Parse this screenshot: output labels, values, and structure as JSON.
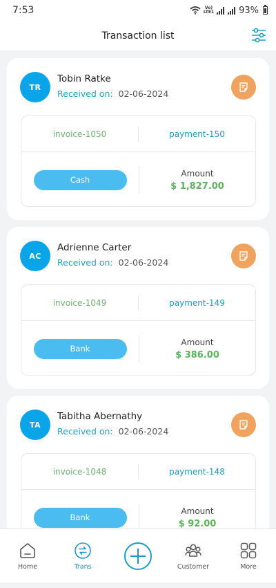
{
  "status_bar": {
    "time": "7:53",
    "lte_top": "Vo)",
    "lte_bottom": "LTE1",
    "battery": "93%"
  },
  "header": {
    "title": "Transaction list",
    "filter_icon": "sliders-icon"
  },
  "amount_label": "Amount",
  "received_label": "Received on:",
  "transactions": [
    {
      "initials": "TR",
      "name": "Tobin Ratke",
      "date": "02-06-2024",
      "invoice": "invoice-1050",
      "payment": "payment-150",
      "method": "Cash",
      "amount": "$ 1,827.00"
    },
    {
      "initials": "AC",
      "name": "Adrienne Carter",
      "date": "02-06-2024",
      "invoice": "invoice-1049",
      "payment": "payment-149",
      "method": "Bank",
      "amount": "$ 386.00"
    },
    {
      "initials": "TA",
      "name": "Tabitha Abernathy",
      "date": "02-06-2024",
      "invoice": "invoice-1048",
      "payment": "payment-148",
      "method": "Bank",
      "amount": "$ 92.00"
    }
  ],
  "nav": {
    "home": "Home",
    "trans": "Trans",
    "customer": "Customer",
    "more": "More"
  },
  "colors": {
    "accent": "#1a9ac4",
    "avatar": "#0aa5e8",
    "note": "#f0a35e",
    "amount": "#5bb35d",
    "invoice": "#6bb36f",
    "method_button": "#4bbcf0"
  }
}
